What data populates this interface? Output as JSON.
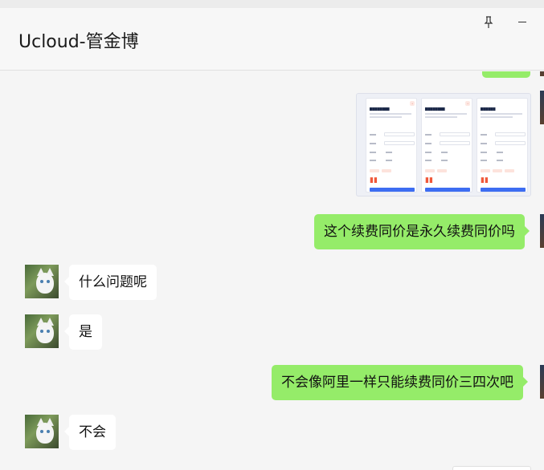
{
  "window": {
    "title": "Ucloud-管金博",
    "pin_icon": "pin-icon",
    "minimize_icon": "minimize-icon"
  },
  "colors": {
    "my_bubble": "#95ec69",
    "other_bubble": "#ffffff",
    "background": "#f5f5f5"
  },
  "messages": [
    {
      "sender": "me",
      "type": "text",
      "text": ""
    },
    {
      "sender": "me",
      "type": "image",
      "text": ""
    },
    {
      "sender": "me",
      "type": "text",
      "text": "这个续费同价是永久续费同价吗"
    },
    {
      "sender": "other",
      "type": "text",
      "text": "什么问题呢"
    },
    {
      "sender": "other",
      "type": "text",
      "text": "是"
    },
    {
      "sender": "me",
      "type": "text",
      "text": "不会像阿里一样只能续费同价三四次吧"
    },
    {
      "sender": "other",
      "type": "text",
      "text": "不会"
    }
  ]
}
